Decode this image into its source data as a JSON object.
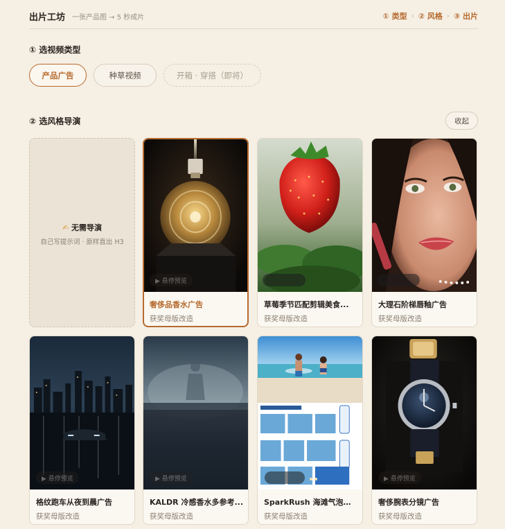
{
  "header": {
    "title": "出片工坊",
    "subtitle": "一张产品图 → 5 秒成片",
    "steps": [
      "① 类型",
      "② 风格",
      "③ 出片"
    ],
    "step_sep": "›"
  },
  "section1": {
    "title": "① 选视频类型",
    "types": [
      {
        "label": "产品广告",
        "state": "active"
      },
      {
        "label": "种草视频",
        "state": "normal"
      },
      {
        "label": "开箱 · 穿搭（即将）",
        "state": "disabled"
      }
    ]
  },
  "section2": {
    "title": "② 选风格导演",
    "collapse_label": "收起",
    "no_director": {
      "icon": "✍",
      "title": "无需导演",
      "subtitle": "自己写提示词 · 原样直出 H3"
    },
    "hover_hint": "▶ 悬停预览",
    "cards": [
      {
        "name": "奢侈品香水广告",
        "tag": "获奖母版改造",
        "selected": true,
        "thumb": "perfume-bottle"
      },
      {
        "name": "草莓季节匹配剪辑美食...",
        "tag": "获奖母版改造",
        "selected": false,
        "thumb": "strawberry"
      },
      {
        "name": "大理石阶梯唇釉广告",
        "tag": "获奖母版改造",
        "selected": false,
        "thumb": "lip-gloss-portrait"
      },
      {
        "name": "格纹跑车从夜到晨广告",
        "tag": "获奖母版改造",
        "selected": false,
        "thumb": "night-city-car"
      },
      {
        "name": "KALDR 冷感香水多参考...",
        "tag": "获奖母版改造",
        "selected": false,
        "thumb": "misty-figure"
      },
      {
        "name": "SparkRush 海滩气泡饮...",
        "tag": "获奖母版改造",
        "selected": false,
        "thumb": "beach-drink-collage"
      },
      {
        "name": "奢侈腕表分镜广告",
        "tag": "获奖母版改造",
        "selected": false,
        "thumb": "luxury-watch"
      }
    ]
  },
  "colors": {
    "background": "#f5efe4",
    "accent": "#b66a2e",
    "text": "#2b2520",
    "muted": "#8a7f72"
  }
}
